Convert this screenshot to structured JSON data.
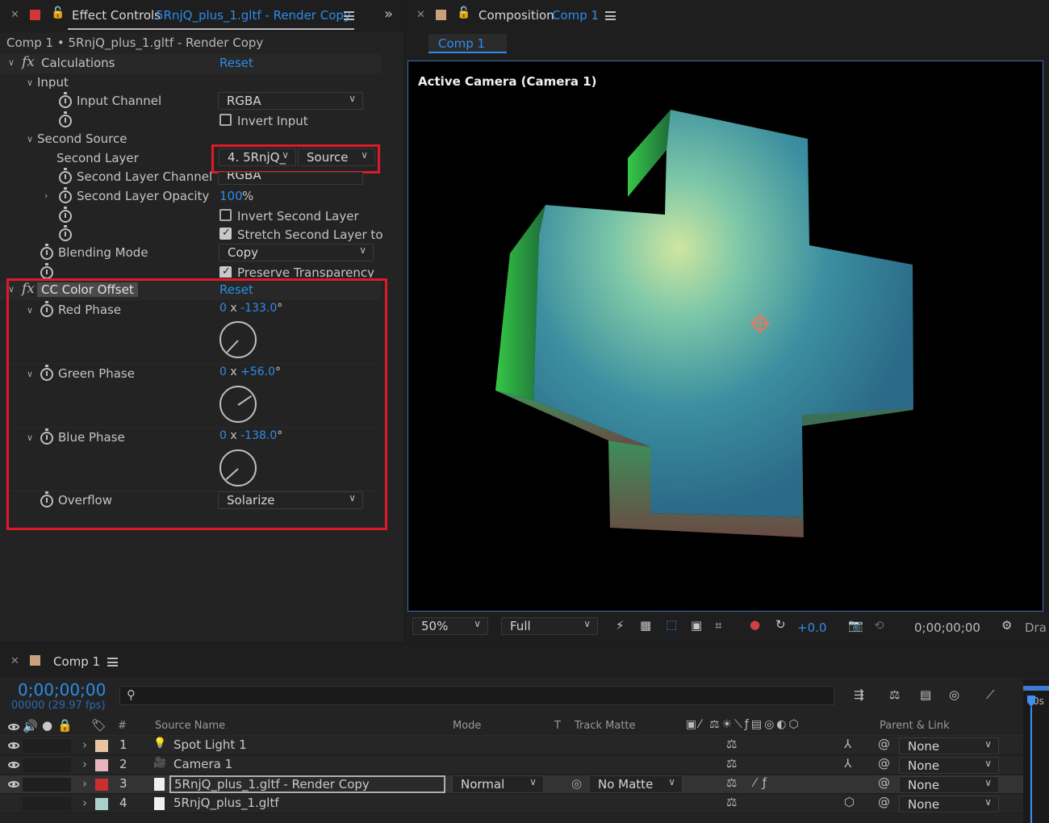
{
  "effect_panel": {
    "tab_label": "Effect Controls",
    "tab_layer": "5RnjQ_plus_1.gltf - Render Copy",
    "breadcrumb": "Comp 1 • 5RnjQ_plus_1.gltf - Render Copy",
    "calculations": {
      "name": "Calculations",
      "reset": "Reset",
      "input_group": "Input",
      "input_channel_label": "Input Channel",
      "input_channel_value": "RGBA",
      "invert_input_label": "Invert Input",
      "second_source_group": "Second Source",
      "second_layer_label": "Second Layer",
      "second_layer_value": "4. 5RnjQ_",
      "second_layer_source": "Source",
      "second_layer_channel_label": "Second Layer Channel",
      "second_layer_channel_value": "RGBA",
      "second_layer_opacity_label": "Second Layer Opacity",
      "second_layer_opacity_value": "100",
      "second_layer_opacity_unit": "%",
      "invert_second_label": "Invert Second Layer",
      "stretch_second_label": "Stretch Second Layer to",
      "blending_mode_label": "Blending Mode",
      "blending_mode_value": "Copy",
      "preserve_label": "Preserve Transparency"
    },
    "color_offset": {
      "name": "CC Color Offset",
      "reset": "Reset",
      "red_label": "Red Phase",
      "red_rev": "0",
      "red_deg": "-133.0",
      "green_label": "Green Phase",
      "green_rev": "0",
      "green_deg": "+56.0",
      "blue_label": "Blue Phase",
      "blue_rev": "0",
      "blue_deg": "-138.0",
      "x_sep": "x",
      "deg_sym": "°",
      "overflow_label": "Overflow",
      "overflow_value": "Solarize"
    }
  },
  "comp_panel": {
    "tab_label": "Composition",
    "tab_comp": "Comp 1",
    "sub_tab": "Comp 1",
    "camera_label": "Active Camera (Camera 1)",
    "zoom": "50%",
    "resolution": "Full",
    "exposure": "+0.0",
    "timecode": "0;00;00;00",
    "draft_label": "Dra"
  },
  "timeline": {
    "tab_label": "Comp 1",
    "timecode": "0;00;00;00",
    "frames": "00000 (29.97 fps)",
    "ruler_label": "0s",
    "columns": {
      "hash": "#",
      "source_name": "Source Name",
      "mode": "Mode",
      "t": "T",
      "track_matte": "Track Matte",
      "parent_link": "Parent & Link"
    },
    "layers": [
      {
        "num": "1",
        "name": "Spot Light 1",
        "parent": "None",
        "color": "#e8c4a0"
      },
      {
        "num": "2",
        "name": "Camera 1",
        "parent": "None",
        "color": "#e8b4c0"
      },
      {
        "num": "3",
        "name": "5RnjQ_plus_1.gltf - Render Copy",
        "mode": "Normal",
        "matte": "No Matte",
        "parent": "None",
        "color": "#c83030"
      },
      {
        "num": "4",
        "name": "5RnjQ_plus_1.gltf",
        "parent": "None",
        "color": "#a8d0c8"
      }
    ]
  },
  "icons": [
    "close-icon",
    "lock-icon",
    "menu-icon",
    "stopwatch-icon",
    "chevron-down-icon",
    "search-icon",
    "eye-icon",
    "camera-icon",
    "light-icon",
    "file-icon"
  ]
}
